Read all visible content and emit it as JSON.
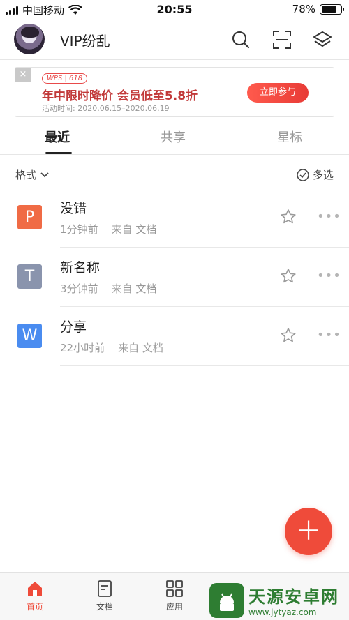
{
  "status_bar": {
    "carrier": "中国移动",
    "time": "20:55",
    "battery": "78%",
    "battery_level": 0.78
  },
  "header": {
    "username": "VIP纷乱",
    "icons": [
      "search-icon",
      "scan-icon",
      "layers-icon"
    ]
  },
  "banner": {
    "close": "×",
    "tag": "WPS | 618",
    "title": "年中限时降价 会员低至5.8折",
    "subtitle": "活动时间: 2020.06.15–2020.06.19",
    "button": "立即参与"
  },
  "tabs": {
    "items": [
      {
        "label": "最近",
        "active": true
      },
      {
        "label": "共享",
        "active": false
      },
      {
        "label": "星标",
        "active": false
      }
    ]
  },
  "filter": {
    "format_label": "格式",
    "multi_select_label": "多选"
  },
  "files": [
    {
      "name": "没错",
      "icon_letter": "P",
      "icon_color": "#f06b45",
      "meta": "1分钟前    来自 文档"
    },
    {
      "name": "新名称",
      "icon_letter": "T",
      "icon_color": "#8a94ad",
      "meta": "3分钟前    来自 文档"
    },
    {
      "name": "分享",
      "icon_letter": "W",
      "icon_color": "#4a8cf0",
      "meta": "22小时前    来自 文档"
    }
  ],
  "fab": {
    "label": "+"
  },
  "bottom_nav": {
    "items": [
      {
        "label": "首页",
        "active": true
      },
      {
        "label": "文档",
        "active": false
      },
      {
        "label": "应用",
        "active": false
      }
    ]
  },
  "watermark": {
    "title": "天源安卓网",
    "url": "www.jytyaz.com"
  },
  "colors": {
    "accent": "#ef4b3a",
    "banner_title": "#c23a3a",
    "watermark": "#2e7d32"
  }
}
